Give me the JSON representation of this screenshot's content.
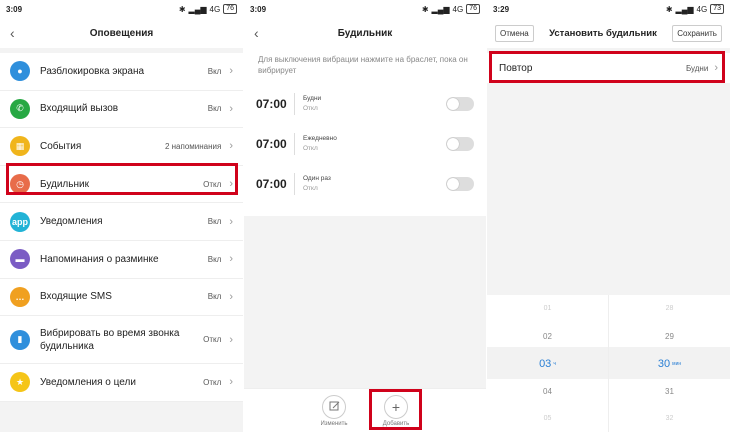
{
  "panel1": {
    "status": {
      "time": "3:09",
      "net": "4G",
      "battery": "76"
    },
    "title": "Оповещения",
    "items": [
      {
        "label": "Разблокировка экрана",
        "value": "Вкл",
        "icon": "unlock-icon",
        "color": "#2f8fdc"
      },
      {
        "label": "Входящий вызов",
        "value": "Вкл",
        "icon": "phone-icon",
        "color": "#27a843"
      },
      {
        "label": "События",
        "value": "2 напоминания",
        "icon": "calendar-icon",
        "color": "#f0b51c"
      },
      {
        "label": "Будильник",
        "value": "Откл",
        "icon": "clock-icon",
        "color": "#e86c4a"
      },
      {
        "label": "Уведомления",
        "value": "Вкл",
        "icon": "app-icon",
        "color": "#22b3d6",
        "glyph": "app"
      },
      {
        "label": "Напоминания о разминке",
        "value": "Вкл",
        "icon": "sofa-icon",
        "color": "#7b5cc4"
      },
      {
        "label": "Входящие SMS",
        "value": "Вкл",
        "icon": "sms-icon",
        "color": "#f0a020"
      },
      {
        "label": "Вибрировать во время звонка будильника",
        "value": "Откл",
        "icon": "vibrate-icon",
        "color": "#2f8fdc"
      },
      {
        "label": "Уведомления о цели",
        "value": "Откл",
        "icon": "goal-icon",
        "color": "#f5c518"
      }
    ]
  },
  "panel2": {
    "status": {
      "time": "3:09",
      "net": "4G",
      "battery": "76"
    },
    "title": "Будильник",
    "hint": "Для выключения вибрации нажмите на браслет, пока он вибрирует",
    "alarms": [
      {
        "time": "07:00",
        "repeat": "Будни",
        "state": "Откл"
      },
      {
        "time": "07:00",
        "repeat": "Ежедневно",
        "state": "Откл"
      },
      {
        "time": "07:00",
        "repeat": "Один раз",
        "state": "Откл"
      }
    ],
    "edit_label": "Изменить",
    "add_label": "Добавить"
  },
  "panel3": {
    "status": {
      "time": "3:29",
      "net": "4G",
      "battery": "73"
    },
    "cancel": "Отмена",
    "title": "Установить будильник",
    "save": "Сохранить",
    "repeat_label": "Повтор",
    "repeat_value": "Будни",
    "hours": [
      "01",
      "02",
      "03",
      "04",
      "05"
    ],
    "minutes": [
      "28",
      "29",
      "30",
      "31",
      "32"
    ],
    "hour_unit": "ч",
    "minute_unit": "мин"
  },
  "highlight_color": "#d0021b"
}
